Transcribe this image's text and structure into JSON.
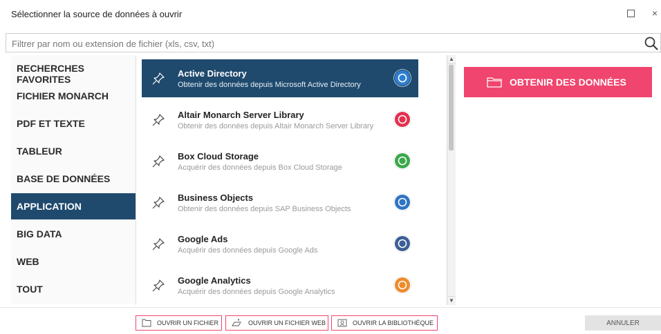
{
  "window": {
    "title": "Sélectionner la source de données à ouvrir",
    "maximize_icon": "maximize-icon",
    "close_icon": "close-icon",
    "close_glyph": "×"
  },
  "search": {
    "placeholder": "Filtrer par nom ou extension de fichier (xls, csv, txt)",
    "value": "",
    "icon": "search-icon"
  },
  "sidebar": {
    "items": [
      {
        "label": "RECHERCHES FAVORITES",
        "active": false
      },
      {
        "label": "FICHIER MONARCH",
        "active": false
      },
      {
        "label": "PDF ET TEXTE",
        "active": false
      },
      {
        "label": "TABLEUR",
        "active": false
      },
      {
        "label": "BASE DE DONNÉES",
        "active": false
      },
      {
        "label": "APPLICATION",
        "active": true
      },
      {
        "label": "BIG DATA",
        "active": false
      },
      {
        "label": "WEB",
        "active": false
      },
      {
        "label": "TOUT",
        "active": false
      }
    ]
  },
  "sources": [
    {
      "name": "Active Directory",
      "description": "Obtenir des données depuis Microsoft Active Directory",
      "color": "#2f7fd1",
      "selected": true,
      "icon": "pin-icon"
    },
    {
      "name": "Altair Monarch Server Library",
      "description": "Obtenir des données depuis Altair Monarch Server Library",
      "color": "#e3304f",
      "selected": false,
      "icon": "pin-icon"
    },
    {
      "name": "Box Cloud Storage",
      "description": "Acquérir des données depuis Box Cloud Storage",
      "color": "#3aa84a",
      "selected": false,
      "icon": "pin-icon"
    },
    {
      "name": "Business Objects",
      "description": "Obtenir des données depuis SAP Business Objects",
      "color": "#2e74c4",
      "selected": false,
      "icon": "pin-icon"
    },
    {
      "name": "Google Ads",
      "description": "Acquérir des données depuis Google Ads",
      "color": "#3d5f96",
      "selected": false,
      "icon": "pin-icon"
    },
    {
      "name": "Google Analytics",
      "description": "Acquérir des données depuis Google Analytics",
      "color": "#ef8a2b",
      "selected": false,
      "icon": "pin-icon"
    }
  ],
  "scrollbar": {
    "up_glyph": "▲",
    "down_glyph": "▼"
  },
  "actions": {
    "get_data_label": "OBTENIR DES DONNÉES",
    "get_data_icon": "folder-icon",
    "open_file_label": "OUVRIR UN FICHIER",
    "open_web_file_label": "OUVRIR UN FICHIER WEB",
    "open_library_label": "OUVRIR LA BIBLIOTHÈQUE",
    "cancel_label": "ANNULER"
  },
  "colors": {
    "accent": "#f0456e",
    "selected_bg": "#1f4a6e"
  }
}
